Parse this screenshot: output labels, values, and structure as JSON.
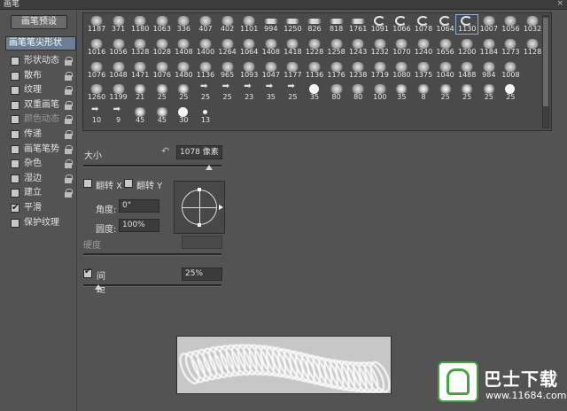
{
  "window": {
    "title": "画笔",
    "close_glyph": "×"
  },
  "left_panel": {
    "preset_button": "画笔预设",
    "tip_shape_label": "画笔笔尖形状",
    "options": [
      {
        "label": "形状动态",
        "checked": false,
        "dim": false
      },
      {
        "label": "散布",
        "checked": false,
        "dim": false
      },
      {
        "label": "纹理",
        "checked": false,
        "dim": false
      },
      {
        "label": "双重画笔",
        "checked": false,
        "dim": false
      },
      {
        "label": "颜色动态",
        "checked": false,
        "dim": true
      },
      {
        "label": "传递",
        "checked": false,
        "dim": false
      },
      {
        "label": "画笔笔势",
        "checked": false,
        "dim": false
      },
      {
        "label": "杂色",
        "checked": false,
        "dim": false
      },
      {
        "label": "湿边",
        "checked": false,
        "dim": false
      },
      {
        "label": "建立",
        "checked": false,
        "dim": false
      },
      {
        "label": "平滑",
        "checked": true,
        "dim": false
      },
      {
        "label": "保护纹理",
        "checked": false,
        "dim": false
      }
    ]
  },
  "brush_grid": {
    "selected_index": 17,
    "rows": [
      [
        "1187",
        "371",
        "1180",
        "1063",
        "336",
        "407",
        "402",
        "1101",
        "994",
        "1250",
        "826",
        "818",
        "1761",
        "1091",
        "1066",
        "1078",
        "1064",
        "1130",
        "1007",
        "1056",
        "1032"
      ],
      [
        "1016",
        "1056",
        "1328",
        "1028",
        "1408",
        "1400",
        "1264",
        "1064",
        "1408",
        "1418",
        "1228",
        "1258",
        "1243",
        "1232",
        "1070",
        "1240",
        "1656",
        "1200",
        "1184",
        "1273",
        "1128"
      ],
      [
        "1076",
        "1048",
        "1471",
        "1076",
        "1480",
        "1136",
        "965",
        "1093",
        "1047",
        "1177",
        "1136",
        "1176",
        "1238",
        "1719",
        "1080",
        "1375",
        "1040",
        "1488",
        "984",
        "1008"
      ],
      [
        "1260",
        "1199",
        "21",
        "25",
        "25",
        "25",
        "25",
        "23",
        "35",
        "25",
        "35",
        "80",
        "80",
        "100",
        "35",
        "8",
        "25",
        "25",
        "25",
        "25"
      ],
      [
        "10",
        "9",
        "45",
        "45",
        "30",
        "13"
      ]
    ]
  },
  "size": {
    "label": "大小",
    "value": "1078 像素",
    "reset_icon": "↶"
  },
  "flip": {
    "x_label": "翻转 X",
    "y_label": "翻转 Y"
  },
  "angle": {
    "label": "角度:",
    "value": "0°"
  },
  "roundness": {
    "label": "圆度:",
    "value": "100%"
  },
  "hardness": {
    "label": "硬度"
  },
  "spacing": {
    "label": "间距",
    "value": "25%",
    "checked": true
  },
  "watermark": {
    "brand": "巴士下载",
    "url": "www.11684.com"
  }
}
